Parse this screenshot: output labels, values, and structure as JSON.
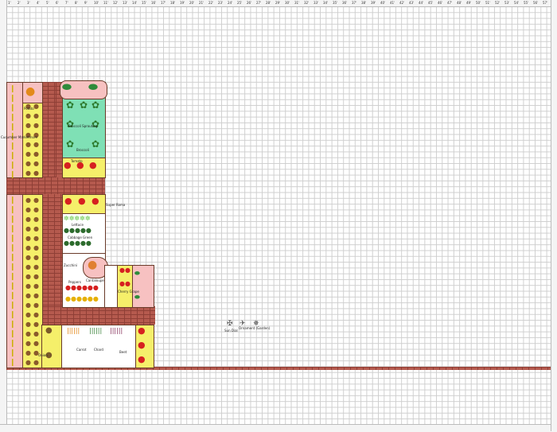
{
  "ruler": {
    "top_ticks": [
      "1'",
      "2'",
      "3'",
      "4'",
      "5'",
      "6'",
      "7'",
      "8'",
      "9'",
      "10'",
      "11'",
      "12'",
      "13'",
      "14'",
      "15'",
      "16'",
      "17'",
      "18'",
      "19'",
      "20'",
      "21'",
      "22'",
      "23'",
      "24'",
      "25'",
      "26'",
      "27'",
      "28'",
      "29'",
      "30'",
      "31'",
      "32'",
      "33'",
      "34'",
      "35'",
      "36'",
      "37'",
      "38'",
      "39'",
      "40'",
      "41'",
      "42'",
      "43'",
      "44'",
      "45'",
      "46'",
      "47'",
      "48'",
      "49'",
      "50'",
      "51'",
      "52'",
      "53'",
      "54'",
      "55'",
      "56'",
      "57'"
    ]
  },
  "labels": {
    "cucumber_marketmore": "Cucumber Marketmore",
    "potato": "Potato",
    "broccoli_small": "Broccoli Sprouting",
    "broccoli": "Broccoli",
    "tomato": "Tomato",
    "super_roma": "Super Roma",
    "lettuce": "Lettuce",
    "cabbage_green": "Cabbage Green",
    "zucchini": "Zucchini",
    "cantaloupe": "Cantaloupe",
    "peppers": "Peppers",
    "cherry_grape": "Cherry Grape",
    "onion": "Onion",
    "carrot": "Carrot",
    "beet": "Beet",
    "chard": "Chard",
    "compost": "Compost",
    "sundial": "Sun Dial",
    "ornament": "Ornament (Garden)",
    "squash": "Squash"
  },
  "colors": {
    "path": "#b55a4e",
    "yellow_bed": "#f5ef6a",
    "pink_bed": "#f7c1c1",
    "green_bed": "#7fe0b5",
    "white_bed": "#ffffff"
  }
}
